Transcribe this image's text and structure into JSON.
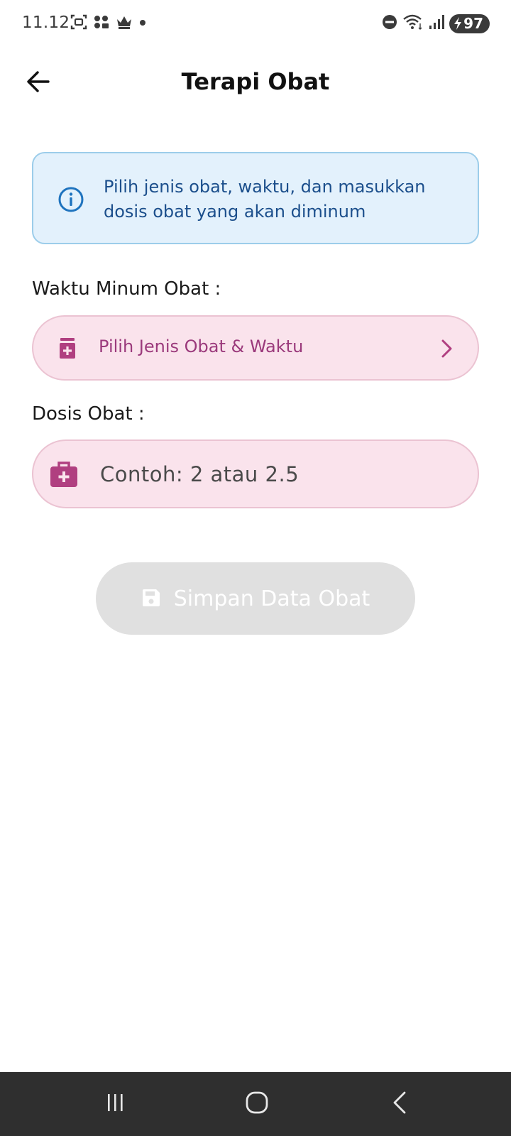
{
  "status_bar": {
    "time": "11.12",
    "battery": "97",
    "icons": [
      "screenshot-icon",
      "people-icon",
      "crown-icon",
      "dot-icon",
      "dnd-icon",
      "wifi-icon",
      "signal-icon",
      "battery-icon"
    ]
  },
  "header": {
    "title": "Terapi Obat",
    "back_icon": "arrow-left-icon"
  },
  "info": {
    "text": "Pilih jenis obat, waktu, dan masukkan dosis obat yang akan diminum",
    "icon": "info-icon"
  },
  "schedule": {
    "label": "Waktu Minum Obat :",
    "select_text": "Pilih Jenis Obat & Waktu",
    "icon": "medicine-bottle-icon"
  },
  "dose": {
    "label": "Dosis Obat :",
    "placeholder": "Contoh: 2 atau 2.5",
    "value": "",
    "icon": "medical-bag-icon"
  },
  "save_button": {
    "label": "Simpan Data Obat",
    "icon": "save-icon",
    "enabled": false
  },
  "colors": {
    "accent": "#b03f80",
    "field_bg": "#fae3ec",
    "info_bg": "#e3f1fc",
    "info_text": "#1c4f8c",
    "disabled_button": "#e0e0e0",
    "nav_bar": "#2f2f2f"
  },
  "nav_bar": {
    "icons": [
      "recent-apps-icon",
      "home-icon",
      "back-icon"
    ]
  }
}
